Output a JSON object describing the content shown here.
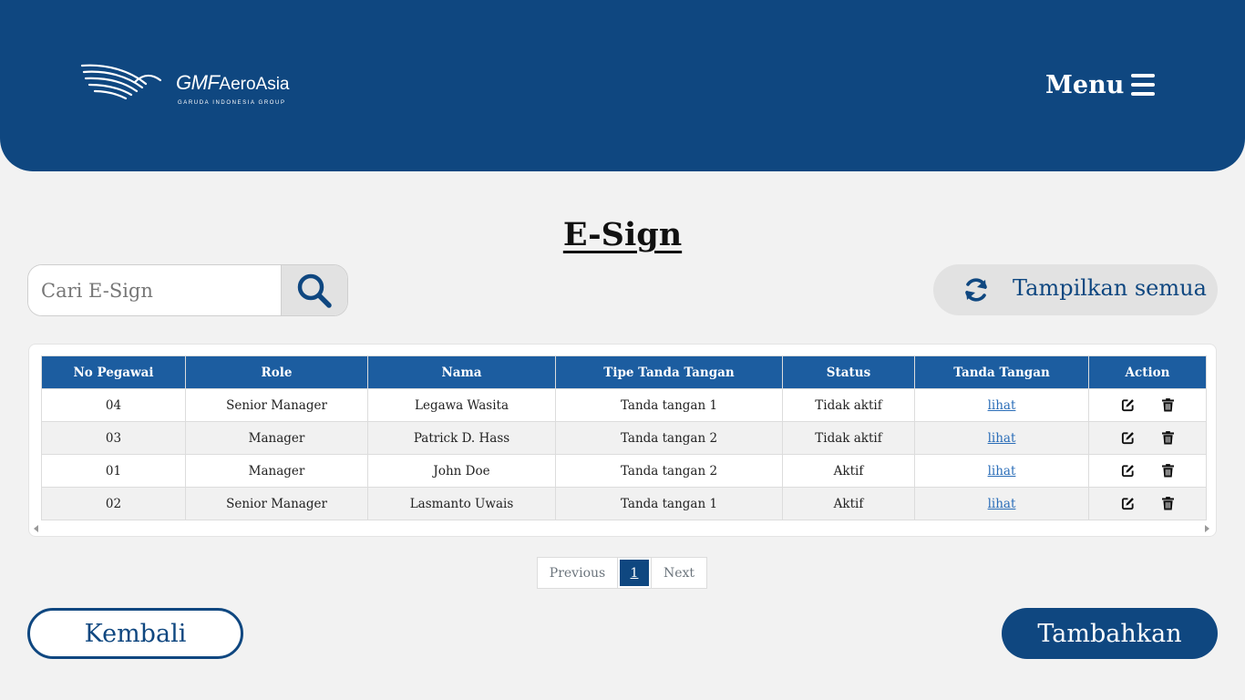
{
  "header": {
    "logo": {
      "name": "GMF",
      "name_sub": "AeroAsia",
      "tagline": "GARUDA INDONESIA GROUP",
      "icon": "garuda-bird-logo"
    },
    "menu_label": "Menu",
    "menu_icon": "hamburger-icon",
    "bg_color": "#0f4780"
  },
  "page": {
    "title": "E-Sign"
  },
  "search": {
    "placeholder": "Cari E-Sign",
    "value": "",
    "icon": "search-icon"
  },
  "show_all": {
    "label": "Tampilkan semua",
    "icon": "refresh-icon"
  },
  "table": {
    "columns": [
      "No Pegawai",
      "Role",
      "Nama",
      "Tipe Tanda Tangan",
      "Status",
      "Tanda Tangan",
      "Action"
    ],
    "rows": [
      {
        "no": "04",
        "role": "Senior Manager",
        "nama": "Legawa Wasita",
        "tipe": "Tanda tangan 1",
        "status": "Tidak aktif",
        "link": "lihat"
      },
      {
        "no": "03",
        "role": "Manager",
        "nama": "Patrick D. Hass",
        "tipe": "Tanda tangan 2",
        "status": "Tidak aktif",
        "link": "lihat"
      },
      {
        "no": "01",
        "role": "Manager",
        "nama": "John Doe",
        "tipe": "Tanda tangan 2",
        "status": "Aktif",
        "link": "lihat"
      },
      {
        "no": "02",
        "role": "Senior Manager",
        "nama": "Lasmanto Uwais",
        "tipe": "Tanda tangan 1",
        "status": "Aktif",
        "link": "lihat"
      }
    ],
    "action_icons": [
      "edit-icon",
      "trash-icon"
    ],
    "header_color": "#1c5da0"
  },
  "pagination": {
    "previous": "Previous",
    "current": "1",
    "next": "Next"
  },
  "footer": {
    "back_label": "Kembali",
    "add_label": "Tambahkan"
  }
}
